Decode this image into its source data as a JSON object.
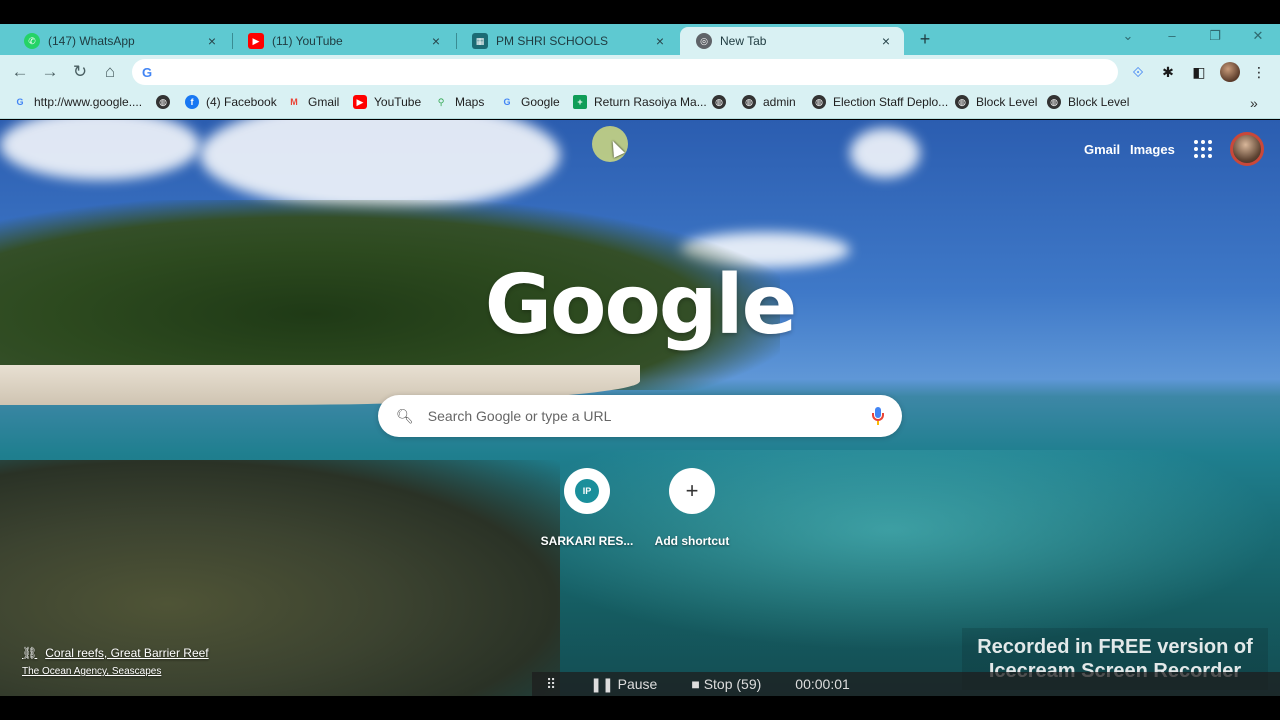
{
  "tabs": [
    {
      "title": "(147) WhatsApp",
      "icon": "whatsapp-icon",
      "color": "#25d366"
    },
    {
      "title": "(11) YouTube",
      "icon": "youtube-icon",
      "color": "#ff0000"
    },
    {
      "title": "PM SHRI SCHOOLS",
      "icon": "pm-shri-icon",
      "color": "#1b6b74"
    },
    {
      "title": "New Tab",
      "icon": "chrome-icon",
      "color": "#5f6368",
      "active": true
    }
  ],
  "omnibox": {
    "value": "",
    "placeholder": ""
  },
  "bookmarks": [
    {
      "label": "http://www.google....",
      "icon": "google-icon"
    },
    {
      "label": "",
      "icon": "globe-icon"
    },
    {
      "label": "(4) Facebook",
      "icon": "facebook-icon"
    },
    {
      "label": "Gmail",
      "icon": "gmail-icon"
    },
    {
      "label": "YouTube",
      "icon": "youtube-icon"
    },
    {
      "label": "Maps",
      "icon": "maps-icon"
    },
    {
      "label": "Google",
      "icon": "google-icon"
    },
    {
      "label": "Return Rasoiya Ma...",
      "icon": "sheets-icon"
    },
    {
      "label": "",
      "icon": "globe-icon"
    },
    {
      "label": "admin",
      "icon": "globe-icon"
    },
    {
      "label": "Election Staff Deplo...",
      "icon": "globe-icon"
    },
    {
      "label": "Block Level",
      "icon": "globe-icon"
    },
    {
      "label": "Block Level",
      "icon": "globe-icon"
    }
  ],
  "header_links": {
    "gmail": "Gmail",
    "images": "Images"
  },
  "logo": "Google",
  "search": {
    "placeholder": "Search Google or type a URL"
  },
  "shortcuts": [
    {
      "label": "SARKARI RES...",
      "initials": "IP"
    },
    {
      "label": "Add shortcut"
    }
  ],
  "attribution": {
    "title": "Coral reefs, Great Barrier Reef",
    "credit": "The Ocean Agency, Seascapes"
  },
  "watermark": {
    "line1": "Recorded in FREE version of",
    "line2": "Icecream  Screen  Recorder"
  },
  "recorder": {
    "pause": "Pause",
    "stop": "Stop",
    "count": "(59)",
    "time": "00:00:01"
  },
  "colors": {
    "tabstrip": "#5ec9d1",
    "toolbar": "#d9f1f3",
    "accent": "#4285f4"
  }
}
